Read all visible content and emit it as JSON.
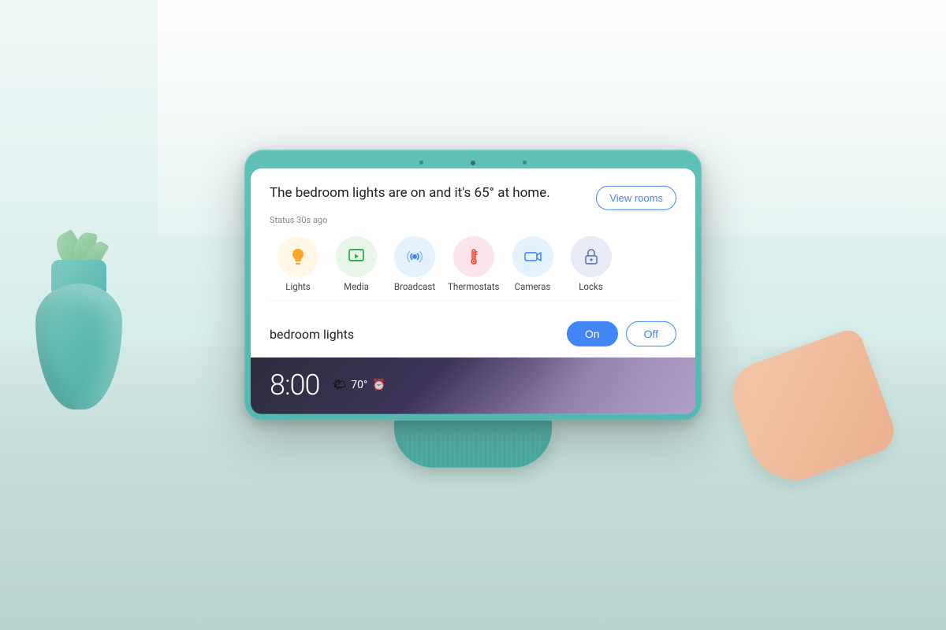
{
  "background": {
    "color": "#e8f0ee"
  },
  "device": {
    "screen": {
      "status_message": "The bedroom lights are on and it's 65° at home.",
      "status_time": "Status 30s ago",
      "view_rooms_label": "View rooms",
      "quick_actions": [
        {
          "id": "lights",
          "label": "Lights",
          "icon_type": "bulb",
          "icon_color": "#f9a825",
          "bg": "#fff8e6"
        },
        {
          "id": "media",
          "label": "Media",
          "icon_type": "play",
          "icon_color": "#34a853",
          "bg": "#e8f5e9"
        },
        {
          "id": "broadcast",
          "label": "Broadcast",
          "icon_type": "broadcast",
          "icon_color": "#4285f4",
          "bg": "#e3f2fd"
        },
        {
          "id": "thermostats",
          "label": "Thermostats",
          "icon_type": "thermometer",
          "icon_color": "#ea4335",
          "bg": "#fce4ec"
        },
        {
          "id": "cameras",
          "label": "Cameras",
          "icon_type": "camera",
          "icon_color": "#4285f4",
          "bg": "#e3f2fd"
        },
        {
          "id": "locks",
          "label": "Locks",
          "icon_type": "lock",
          "icon_color": "#5c6bc0",
          "bg": "#e8eaf6"
        }
      ],
      "lights_control": {
        "label": "bedroom lights",
        "on_label": "On",
        "off_label": "Off",
        "active": "on"
      },
      "ambient": {
        "time": "8:00",
        "temperature": "70°",
        "has_alarm": true
      }
    }
  }
}
